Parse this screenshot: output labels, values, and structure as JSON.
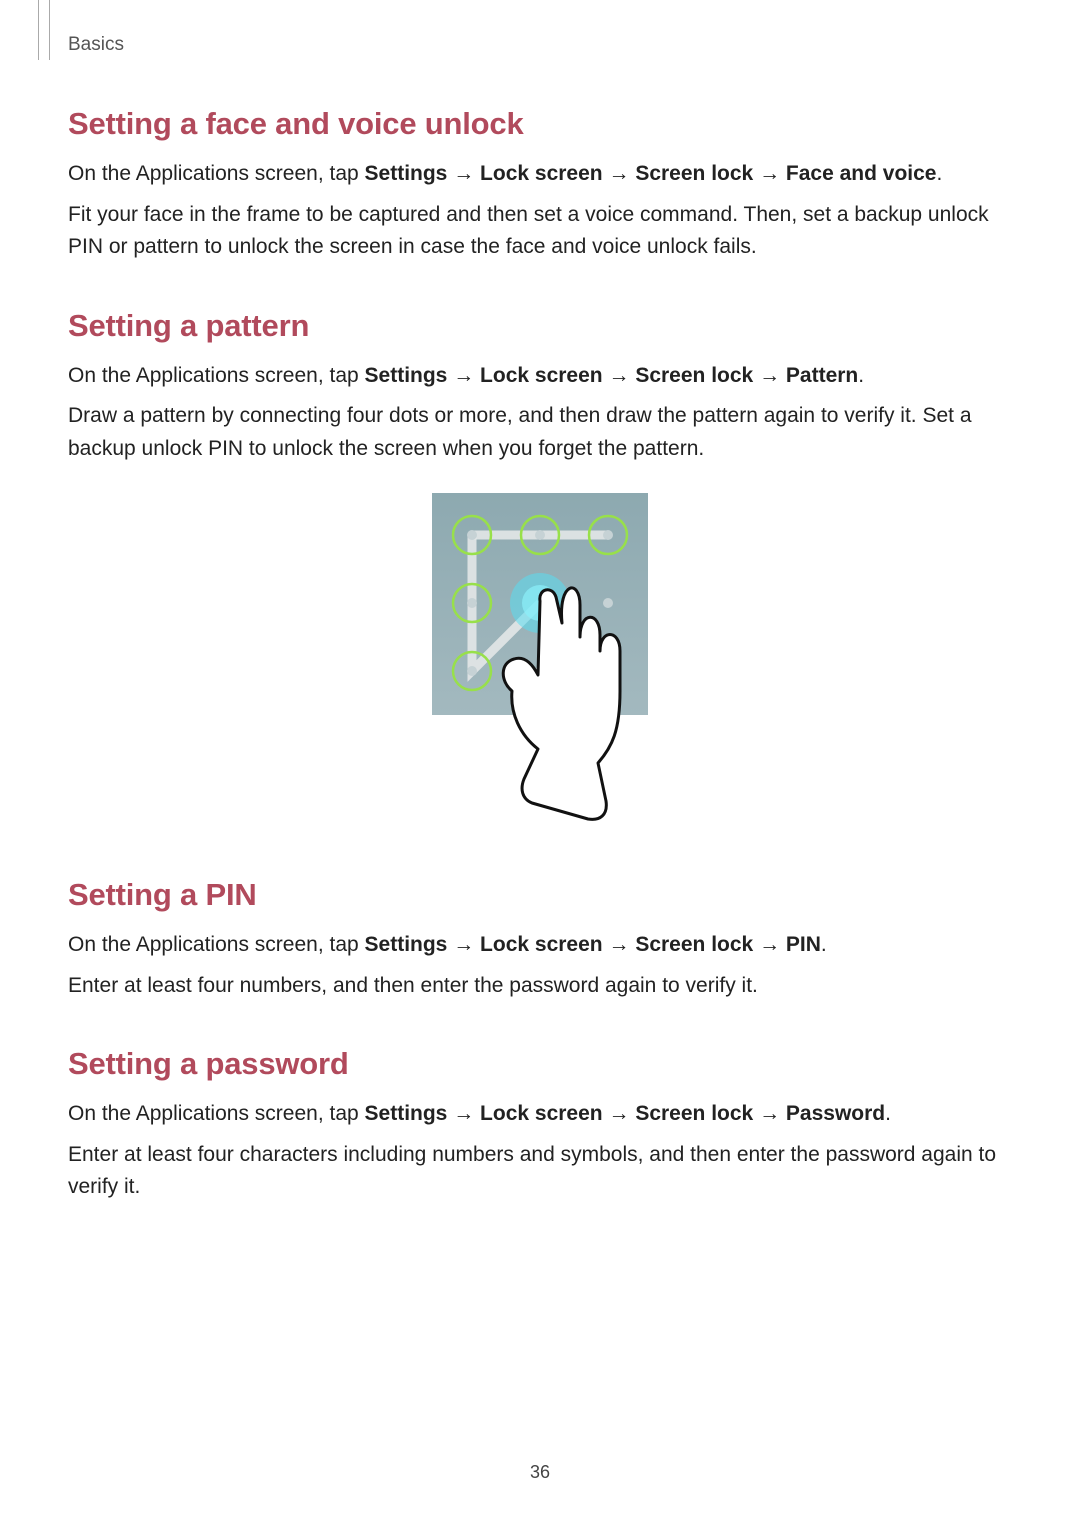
{
  "header": {
    "label": "Basics"
  },
  "sections": {
    "s1": {
      "heading": "Setting a face and voice unlock",
      "p1_prefix": "On the Applications screen, tap ",
      "p1_path_parts": [
        "Settings",
        "Lock screen",
        "Screen lock",
        "Face and voice"
      ],
      "p1_suffix": ".",
      "p2": "Fit your face in the frame to be captured and then set a voice command. Then, set a backup unlock PIN or pattern to unlock the screen in case the face and voice unlock fails."
    },
    "s2": {
      "heading": "Setting a pattern",
      "p1_prefix": "On the Applications screen, tap ",
      "p1_path_parts": [
        "Settings",
        "Lock screen",
        "Screen lock",
        "Pattern"
      ],
      "p1_suffix": ".",
      "p2": "Draw a pattern by connecting four dots or more, and then draw the pattern again to verify it. Set a backup unlock PIN to unlock the screen when you forget the pattern."
    },
    "s3": {
      "heading": "Setting a PIN",
      "p1_prefix": "On the Applications screen, tap ",
      "p1_path_parts": [
        "Settings",
        "Lock screen",
        "Screen lock",
        "PIN"
      ],
      "p1_suffix": ".",
      "p2": "Enter at least four numbers, and then enter the password again to verify it."
    },
    "s4": {
      "heading": "Setting a password",
      "p1_prefix": "On the Applications screen, tap ",
      "p1_path_parts": [
        "Settings",
        "Lock screen",
        "Screen lock",
        "Password"
      ],
      "p1_suffix": ".",
      "p2": "Enter at least four characters including numbers and symbols, and then enter the password again to verify it."
    }
  },
  "arrow": "→",
  "page_number": "36"
}
